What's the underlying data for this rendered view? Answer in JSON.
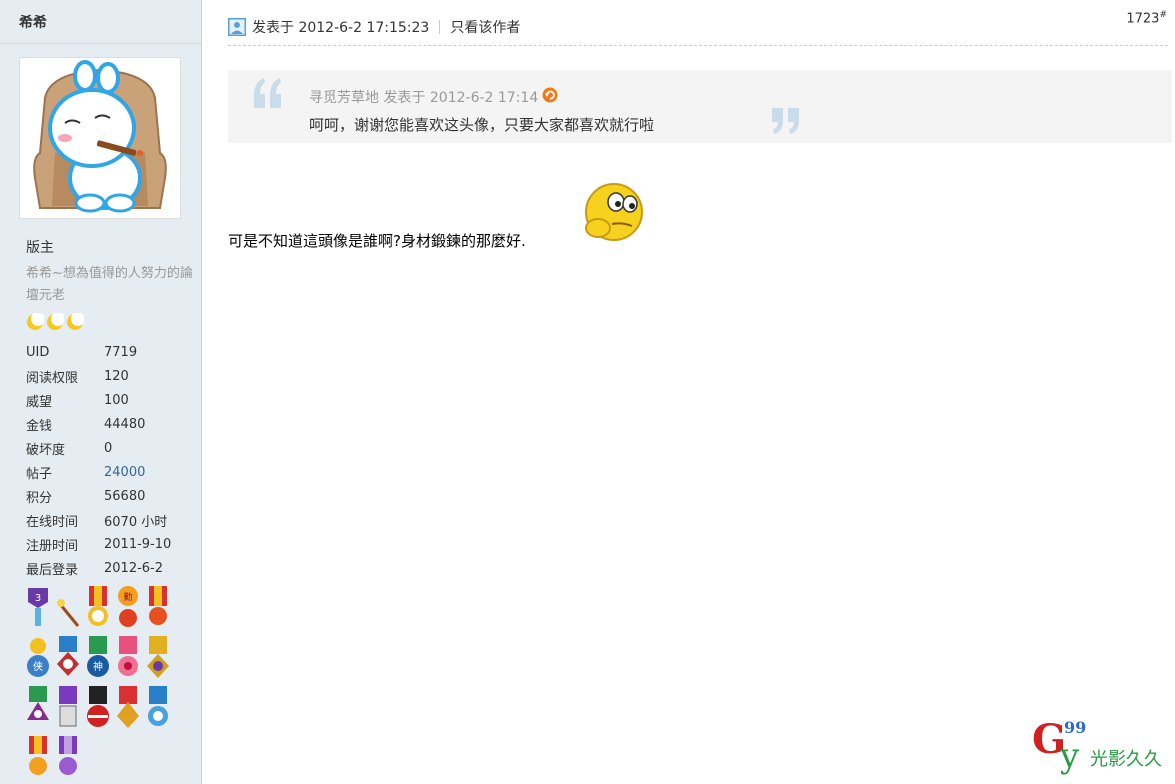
{
  "author": {
    "name": "希希",
    "rank": "版主",
    "title": "希希~想為值得的人努力的論壇元老",
    "stats": [
      {
        "label": "UID",
        "value": "7719",
        "link": false
      },
      {
        "label": "阅读权限",
        "value": "120",
        "link": false
      },
      {
        "label": "威望",
        "value": "100",
        "link": false
      },
      {
        "label": "金钱",
        "value": "44480",
        "link": false
      },
      {
        "label": "破坏度",
        "value": "0",
        "link": false
      },
      {
        "label": "帖子",
        "value": "24000",
        "link": true
      },
      {
        "label": "积分",
        "value": "56680",
        "link": false
      },
      {
        "label": "在线时间",
        "value": "6070 小时",
        "link": false
      },
      {
        "label": "注册时间",
        "value": "2011-9-10",
        "link": false
      },
      {
        "label": "最后登录",
        "value": "2012-6-2",
        "link": false
      }
    ]
  },
  "post": {
    "posted_label": "发表于 2012-6-2 17:15:23",
    "only_author": "只看该作者",
    "floor": "1723",
    "floor_mark": "#",
    "quote_meta": "寻觅芳草地 发表于 2012-6-2 17:14",
    "quote_text": "呵呵，谢谢您能喜欢这头像，只要大家都喜欢就行啦",
    "body": "可是不知道這頭像是誰啊?身材鍛鍊的那麼好."
  },
  "watermark": {
    "g": "G",
    "num": "99",
    "y": "y",
    "text": "光影久久"
  },
  "colors": {
    "sidebar_bg": "#e5edf2",
    "link": "#336699",
    "quote_bg": "#f4f4f4"
  }
}
